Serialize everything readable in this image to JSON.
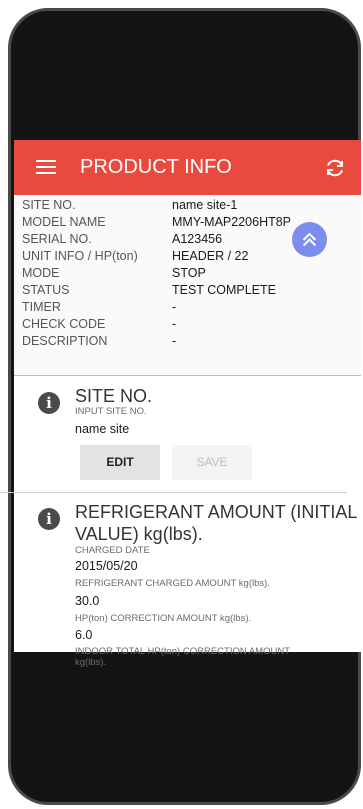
{
  "header": {
    "title": "PRODUCT INFO",
    "menu_icon": "hamburger-menu-icon",
    "refresh_icon": "refresh-icon"
  },
  "colors": {
    "appbar": "#ea4a3d",
    "fab": "#7c8cef"
  },
  "info": [
    {
      "key": "SITE NO.",
      "value": "name site-1"
    },
    {
      "key": "MODEL NAME",
      "value": "MMY-MAP2206HT8P"
    },
    {
      "key": "SERIAL NO.",
      "value": "A123456"
    },
    {
      "key": "UNIT INFO / HP(ton)",
      "value": "HEADER / 22"
    },
    {
      "key": "MODE",
      "value": "STOP"
    },
    {
      "key": "STATUS",
      "value": "TEST COMPLETE"
    },
    {
      "key": "TIMER",
      "value": "-"
    },
    {
      "key": "CHECK CODE",
      "value": "-"
    },
    {
      "key": "DESCRIPTION",
      "value": "-"
    }
  ],
  "site_section": {
    "title": "SITE NO.",
    "input_label": "INPUT SITE NO.",
    "input_value": "name site",
    "edit_label": "EDIT",
    "save_label": "SAVE"
  },
  "refrigerant_section": {
    "title_line1": "REFRIGERANT AMOUNT (INITIAL",
    "title_line2": "VALUE) kg(lbs).",
    "charged_date_label": "CHARGED DATE",
    "charged_date": "2015/05/20",
    "charged_amount_label": "REFRIGERANT CHARGED AMOUNT kg(lbs).",
    "charged_amount": "30.0",
    "hp_correction_label": "HP(ton) CORRECTION AMOUNT kg(lbs).",
    "hp_correction": "6.0",
    "indoor_correction_label_line1": "INDOOR TOTAL HP(ton) CORRECTION AMOUNT",
    "indoor_correction_label_line2": "kg(lbs)."
  }
}
